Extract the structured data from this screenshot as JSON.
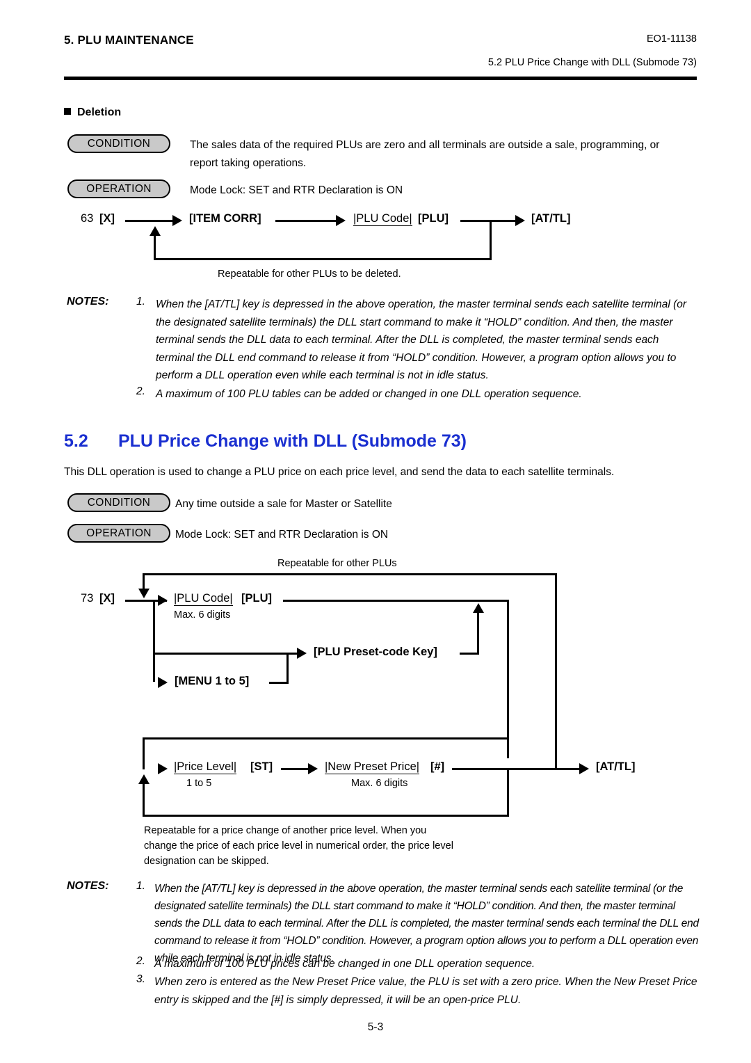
{
  "header": {
    "chapter": "5.  PLU MAINTENANCE",
    "doc_code": "EO1-11138",
    "section_ref": "5.2  PLU Price Change with DLL (Submode 73)"
  },
  "deletion": {
    "heading": "Deletion",
    "condition_label": "CONDITION",
    "condition_text": "The sales data of the required PLUs are zero and all terminals are outside a sale, programming, or report taking operations.",
    "operation_label": "OPERATION",
    "operation_text": "Mode Lock:  SET and RTR Declaration is ON",
    "flow": {
      "start": "63",
      "start_key": "[X]",
      "step2": "[ITEM CORR]",
      "step3_var": "|PLU Code|",
      "step3_key": "[PLU]",
      "step4": "[AT/TL]",
      "loop_caption": "Repeatable for other PLUs to be deleted."
    },
    "notes_label": "NOTES:",
    "notes": [
      {
        "num": "1.",
        "text": "When the [AT/TL] key is depressed in the above operation, the master terminal sends each satellite terminal (or the designated satellite terminals) the DLL start command to make it “HOLD” condition. And then, the master terminal sends the DLL data to each terminal. After the DLL is completed, the master terminal sends each terminal the DLL end command to release it from “HOLD” condition. However, a program option allows you to perform a DLL operation even while each terminal is not in idle status."
      },
      {
        "num": "2.",
        "text": "A maximum of 100 PLU tables can be added or changed in one DLL operation sequence."
      }
    ]
  },
  "section": {
    "number": "5.2",
    "title": "PLU Price Change with DLL (Submode 73)",
    "intro": "This DLL operation is used to change a PLU price on each price level, and send the data to each satellite terminals.",
    "condition_label": "CONDITION",
    "condition_text": "Any time outside a sale for Master or Satellite",
    "operation_label": "OPERATION",
    "operation_text": "Mode Lock:  SET and RTR Declaration is ON"
  },
  "flow2": {
    "top_caption": "Repeatable for other PLUs",
    "start": "73",
    "start_key": "[X]",
    "plu_var": "|PLU Code|",
    "plu_key": "[PLU]",
    "plu_sub": "Max. 6 digits",
    "preset_key": "[PLU Preset-code Key]",
    "menu_key": "[MENU 1 to 5]",
    "price_level_var": "|Price Level|",
    "price_level_key": "[ST]",
    "price_level_sub": "1 to 5",
    "new_price_var": "|New Preset Price|",
    "new_price_key": "[#]",
    "new_price_sub": "Max. 6 digits",
    "end_key": "[AT/TL]",
    "bottom_caption_l1": "Repeatable for a price change of another price level. When you",
    "bottom_caption_l2": "change the price of each price level in numerical order, the price level",
    "bottom_caption_l3": "designation can be skipped."
  },
  "notes2": {
    "label": "NOTES:",
    "items": [
      {
        "num": "1.",
        "text": "When the [AT/TL] key is depressed in the above operation, the master terminal sends each satellite terminal (or the designated satellite terminals) the DLL start command to make it “HOLD” condition. And then, the master terminal sends the DLL data to each terminal. After the DLL is completed, the master terminal sends each terminal the DLL end command to release it from “HOLD” condition. However, a program option allows you to perform a DLL operation even while each terminal is not in idle status."
      },
      {
        "num": "2.",
        "text": "A maximum of 100 PLU prices can be changed in one DLL operation sequence."
      },
      {
        "num": "3.",
        "text": "When zero is entered as the New Preset Price value, the PLU is set with a zero price. When the New Preset Price entry is skipped and the [#] is simply depressed, it will be an open-price PLU."
      }
    ]
  },
  "footer": {
    "page": "5-3"
  }
}
